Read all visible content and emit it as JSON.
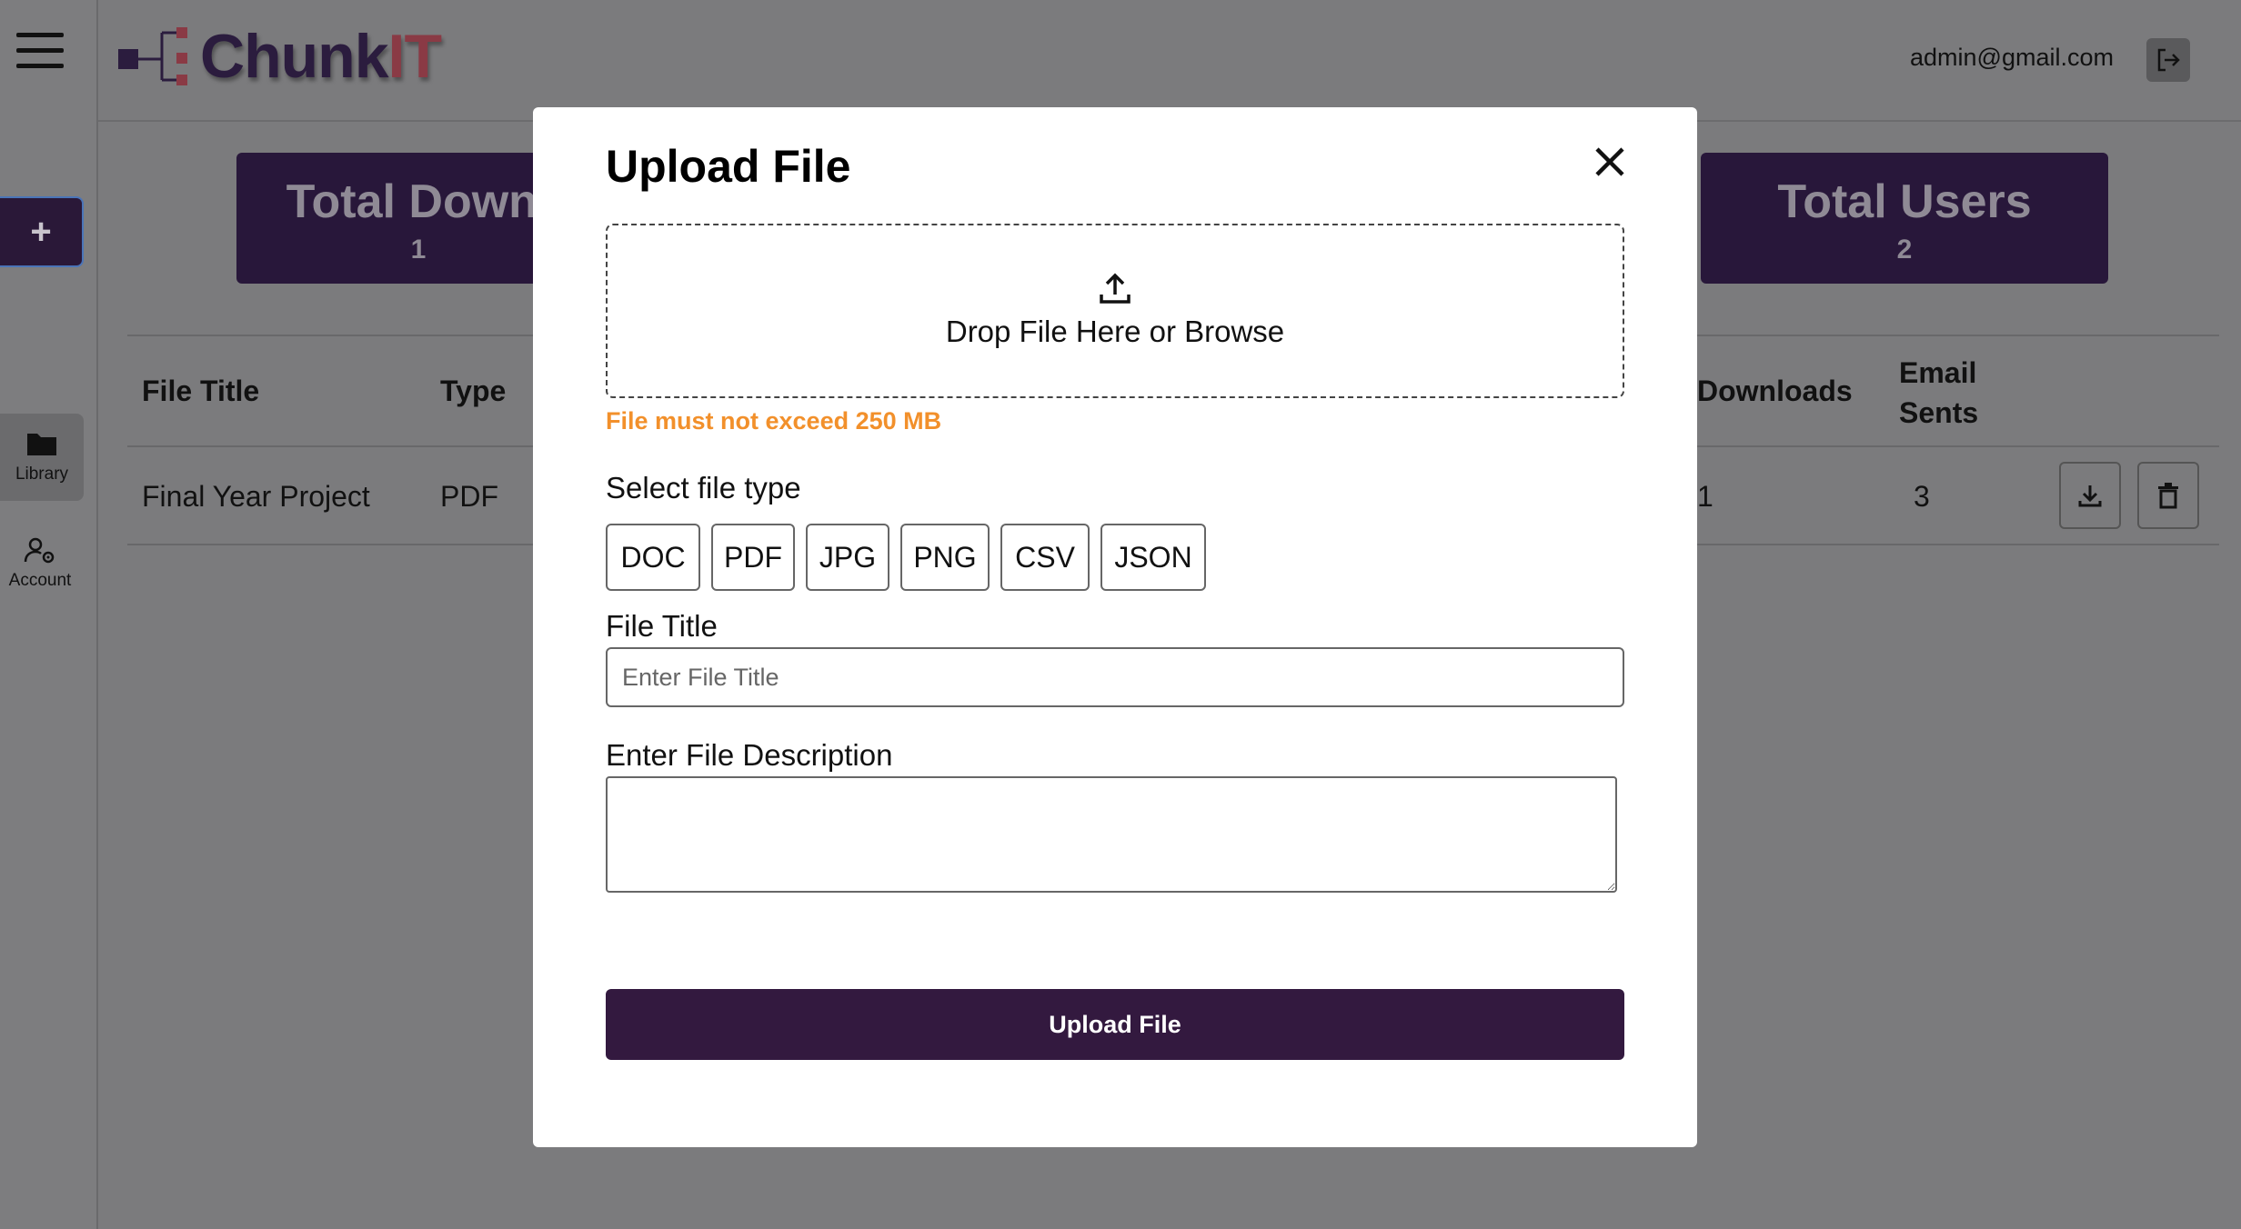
{
  "app": {
    "logo_part1": "Chunk",
    "logo_part2": "IT",
    "user_email": "admin@gmail.com"
  },
  "sidebar": {
    "add_label": "+",
    "items": [
      {
        "label": "Library",
        "icon": "folder-icon"
      },
      {
        "label": "Account",
        "icon": "user-gear-icon"
      }
    ]
  },
  "stats": {
    "downloads": {
      "label": "Total Downl",
      "value": "1"
    },
    "users": {
      "label": "Total Users",
      "value": "2"
    }
  },
  "table": {
    "headers": {
      "file_title": "File Title",
      "type": "Type",
      "downloads": "Downloads",
      "email_sents": "Email Sents"
    },
    "rows": [
      {
        "file_title": "Final Year Project",
        "type": "PDF",
        "downloads": "1",
        "email_sents": "3"
      }
    ]
  },
  "modal": {
    "title": "Upload File",
    "dropzone_text": "Drop File Here or Browse",
    "size_warning": "File must not exceed 250 MB",
    "select_type_label": "Select file type",
    "file_types": [
      "DOC",
      "PDF",
      "JPG",
      "PNG",
      "CSV",
      "JSON"
    ],
    "file_title_label": "File Title",
    "file_title_placeholder": "Enter File Title",
    "file_title_value": "",
    "description_label": "Enter File Description",
    "description_value": "",
    "submit_label": "Upload File"
  },
  "colors": {
    "brand_dark": "#33193f",
    "warning": "#f2902b",
    "overlay": "#7b7b7d"
  }
}
